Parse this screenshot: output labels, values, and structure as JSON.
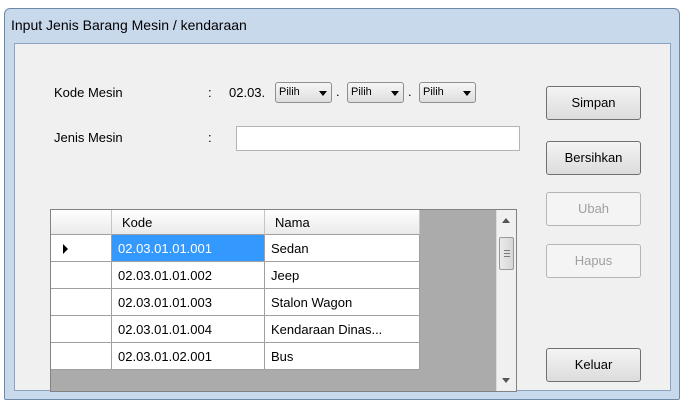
{
  "window": {
    "title": "Input Jenis Barang Mesin / kendaraan"
  },
  "form": {
    "kode_mesin_label": "Kode Mesin",
    "jenis_mesin_label": "Jenis Mesin",
    "colon": ":",
    "prefix": "02.03.",
    "dot": ".",
    "combo1_value": "Pilih",
    "combo2_value": "Pilih",
    "combo3_value": "Pilih",
    "jenis_mesin_value": ""
  },
  "buttons": {
    "simpan": "Simpan",
    "bersihkan": "Bersihkan",
    "ubah": "Ubah",
    "hapus": "Hapus",
    "keluar": "Keluar"
  },
  "grid": {
    "columns": [
      "Kode",
      "Nama"
    ],
    "rows": [
      {
        "kode": "02.03.01.01.001",
        "nama": "Sedan",
        "selected": true
      },
      {
        "kode": "02.03.01.01.002",
        "nama": "Jeep",
        "selected": false
      },
      {
        "kode": "02.03.01.01.003",
        "nama": "Stalon Wagon",
        "selected": false
      },
      {
        "kode": "02.03.01.01.004",
        "nama": "Kendaraan Dinas...",
        "selected": false
      },
      {
        "kode": "02.03.01.02.001",
        "nama": "Bus",
        "selected": false
      }
    ]
  },
  "colors": {
    "selection": "#3399ff",
    "window_frame": "#c9d9ec",
    "client_bg": "#f0f0f0"
  }
}
